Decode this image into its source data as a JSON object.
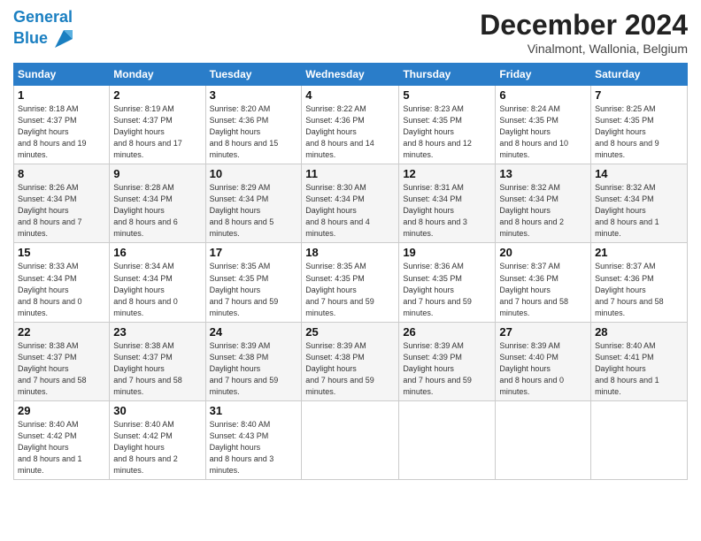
{
  "header": {
    "logo_line1": "General",
    "logo_line2": "Blue",
    "month": "December 2024",
    "location": "Vinalmont, Wallonia, Belgium"
  },
  "days_of_week": [
    "Sunday",
    "Monday",
    "Tuesday",
    "Wednesday",
    "Thursday",
    "Friday",
    "Saturday"
  ],
  "weeks": [
    [
      {
        "day": 1,
        "sunrise": "8:18 AM",
        "sunset": "4:37 PM",
        "daylight": "8 hours and 19 minutes."
      },
      {
        "day": 2,
        "sunrise": "8:19 AM",
        "sunset": "4:37 PM",
        "daylight": "8 hours and 17 minutes."
      },
      {
        "day": 3,
        "sunrise": "8:20 AM",
        "sunset": "4:36 PM",
        "daylight": "8 hours and 15 minutes."
      },
      {
        "day": 4,
        "sunrise": "8:22 AM",
        "sunset": "4:36 PM",
        "daylight": "8 hours and 14 minutes."
      },
      {
        "day": 5,
        "sunrise": "8:23 AM",
        "sunset": "4:35 PM",
        "daylight": "8 hours and 12 minutes."
      },
      {
        "day": 6,
        "sunrise": "8:24 AM",
        "sunset": "4:35 PM",
        "daylight": "8 hours and 10 minutes."
      },
      {
        "day": 7,
        "sunrise": "8:25 AM",
        "sunset": "4:35 PM",
        "daylight": "8 hours and 9 minutes."
      }
    ],
    [
      {
        "day": 8,
        "sunrise": "8:26 AM",
        "sunset": "4:34 PM",
        "daylight": "8 hours and 7 minutes."
      },
      {
        "day": 9,
        "sunrise": "8:28 AM",
        "sunset": "4:34 PM",
        "daylight": "8 hours and 6 minutes."
      },
      {
        "day": 10,
        "sunrise": "8:29 AM",
        "sunset": "4:34 PM",
        "daylight": "8 hours and 5 minutes."
      },
      {
        "day": 11,
        "sunrise": "8:30 AM",
        "sunset": "4:34 PM",
        "daylight": "8 hours and 4 minutes."
      },
      {
        "day": 12,
        "sunrise": "8:31 AM",
        "sunset": "4:34 PM",
        "daylight": "8 hours and 3 minutes."
      },
      {
        "day": 13,
        "sunrise": "8:32 AM",
        "sunset": "4:34 PM",
        "daylight": "8 hours and 2 minutes."
      },
      {
        "day": 14,
        "sunrise": "8:32 AM",
        "sunset": "4:34 PM",
        "daylight": "8 hours and 1 minute."
      }
    ],
    [
      {
        "day": 15,
        "sunrise": "8:33 AM",
        "sunset": "4:34 PM",
        "daylight": "8 hours and 0 minutes."
      },
      {
        "day": 16,
        "sunrise": "8:34 AM",
        "sunset": "4:34 PM",
        "daylight": "8 hours and 0 minutes."
      },
      {
        "day": 17,
        "sunrise": "8:35 AM",
        "sunset": "4:35 PM",
        "daylight": "7 hours and 59 minutes."
      },
      {
        "day": 18,
        "sunrise": "8:35 AM",
        "sunset": "4:35 PM",
        "daylight": "7 hours and 59 minutes."
      },
      {
        "day": 19,
        "sunrise": "8:36 AM",
        "sunset": "4:35 PM",
        "daylight": "7 hours and 59 minutes."
      },
      {
        "day": 20,
        "sunrise": "8:37 AM",
        "sunset": "4:36 PM",
        "daylight": "7 hours and 58 minutes."
      },
      {
        "day": 21,
        "sunrise": "8:37 AM",
        "sunset": "4:36 PM",
        "daylight": "7 hours and 58 minutes."
      }
    ],
    [
      {
        "day": 22,
        "sunrise": "8:38 AM",
        "sunset": "4:37 PM",
        "daylight": "7 hours and 58 minutes."
      },
      {
        "day": 23,
        "sunrise": "8:38 AM",
        "sunset": "4:37 PM",
        "daylight": "7 hours and 58 minutes."
      },
      {
        "day": 24,
        "sunrise": "8:39 AM",
        "sunset": "4:38 PM",
        "daylight": "7 hours and 59 minutes."
      },
      {
        "day": 25,
        "sunrise": "8:39 AM",
        "sunset": "4:38 PM",
        "daylight": "7 hours and 59 minutes."
      },
      {
        "day": 26,
        "sunrise": "8:39 AM",
        "sunset": "4:39 PM",
        "daylight": "7 hours and 59 minutes."
      },
      {
        "day": 27,
        "sunrise": "8:39 AM",
        "sunset": "4:40 PM",
        "daylight": "8 hours and 0 minutes."
      },
      {
        "day": 28,
        "sunrise": "8:40 AM",
        "sunset": "4:41 PM",
        "daylight": "8 hours and 1 minute."
      }
    ],
    [
      {
        "day": 29,
        "sunrise": "8:40 AM",
        "sunset": "4:42 PM",
        "daylight": "8 hours and 1 minute."
      },
      {
        "day": 30,
        "sunrise": "8:40 AM",
        "sunset": "4:42 PM",
        "daylight": "8 hours and 2 minutes."
      },
      {
        "day": 31,
        "sunrise": "8:40 AM",
        "sunset": "4:43 PM",
        "daylight": "8 hours and 3 minutes."
      },
      null,
      null,
      null,
      null
    ]
  ]
}
